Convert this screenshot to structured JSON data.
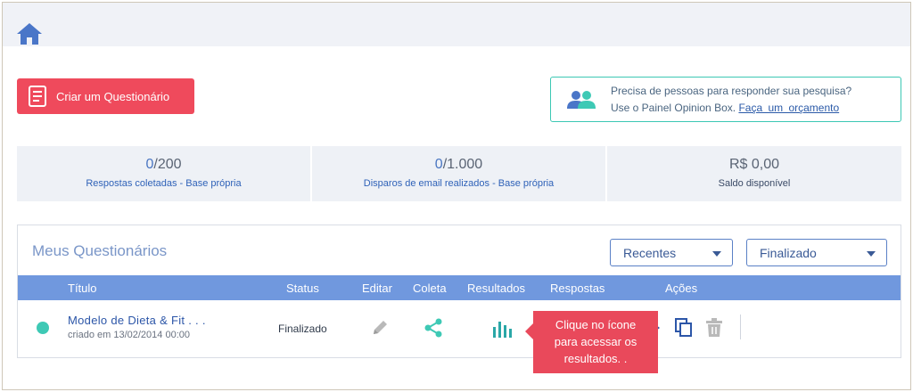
{
  "header": {
    "home_icon": "home-icon"
  },
  "create_button": {
    "label": "Criar um Questionário",
    "icon": "document-icon",
    "color": "#ef4a5c"
  },
  "promo": {
    "line1": "Precisa de pessoas para responder sua pesquisa?",
    "line2_prefix": "Use o Painel Opinion Box.",
    "link_text": "Faça um orçamento",
    "icon": "people-icon",
    "border_color": "#3cc8b4"
  },
  "stats": [
    {
      "value": "0",
      "suffix": "/200",
      "label": "Respostas coletadas - Base própria"
    },
    {
      "value": "0",
      "suffix": "/1.000",
      "label": "Disparos de email realizados - Base própria"
    },
    {
      "value": "R$ 0,00",
      "suffix": "",
      "label": "Saldo disponível"
    }
  ],
  "panel": {
    "title": "Meus Questionários",
    "filter_sort": "Recentes",
    "filter_status": "Finalizado"
  },
  "table": {
    "headers": {
      "titulo": "Título",
      "status": "Status",
      "editar": "Editar",
      "coleta": "Coleta",
      "resultados": "Resultados",
      "respostas": "Respostas",
      "acoes": "Ações"
    },
    "header_color": "#7098de",
    "rows": [
      {
        "title": "Modelo de Dieta & Fit . . .",
        "date": "criado em 13/02/2014 00:00",
        "status": "Finalizado",
        "status_dot_color": "#3ec9b5"
      }
    ]
  },
  "tooltip": {
    "line1": "Clique no ícone",
    "line2": "para acessar os",
    "line3": "resultados. .",
    "color": "#e9495b"
  }
}
